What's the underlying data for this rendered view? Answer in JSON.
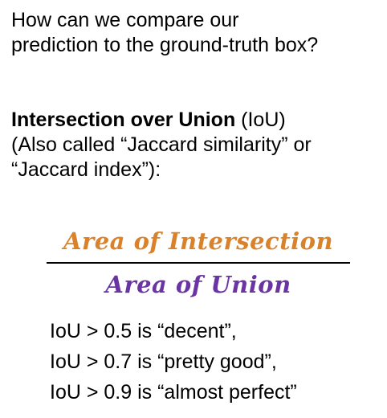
{
  "intro": {
    "line1": "How can we compare our",
    "line2": "prediction to the ground-truth box?"
  },
  "definition": {
    "term": "Intersection over Union",
    "abbreviation": " (IoU)",
    "line2": "(Also called “Jaccard similarity” or",
    "line3": "“Jaccard index”):"
  },
  "formula": {
    "numerator": "Area of Intersection",
    "denominator": "Area of Union",
    "numerator_color": "#d9822b",
    "denominator_color": "#6a35a3"
  },
  "thresholds": [
    "IoU > 0.5 is “decent”,",
    "IoU > 0.7 is “pretty good”,",
    "IoU > 0.9 is “almost perfect”"
  ]
}
